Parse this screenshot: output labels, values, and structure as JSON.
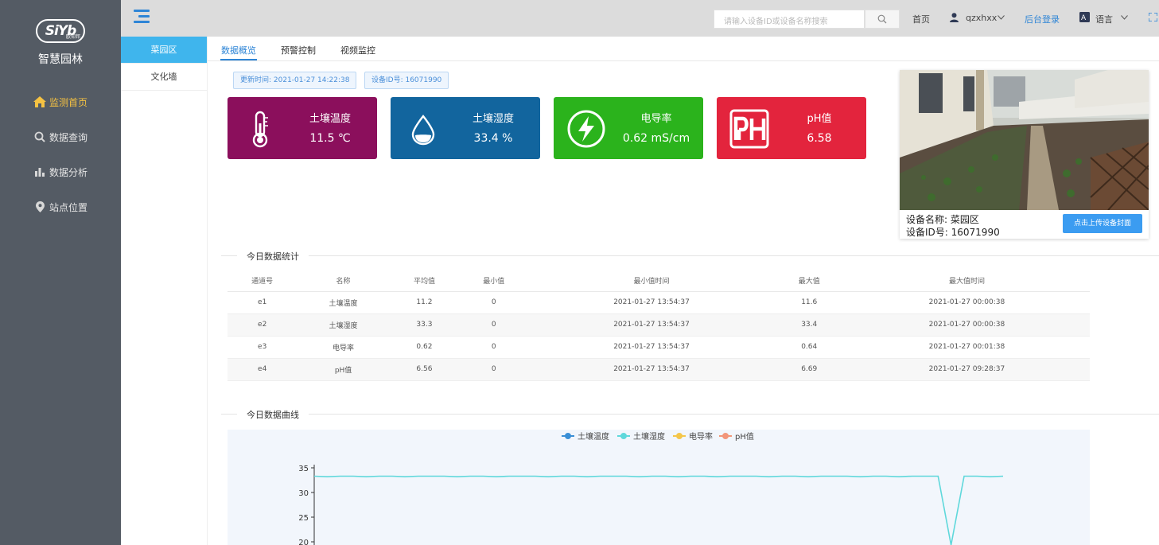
{
  "sidebar": {
    "logo_text": "SiYb",
    "logo_sub": "欧仰邦",
    "app_title": "智慧园林",
    "items": [
      {
        "label": "监测首页",
        "icon": "home-icon",
        "active": true
      },
      {
        "label": "数据查询",
        "icon": "search-icon",
        "active": false
      },
      {
        "label": "数据分析",
        "icon": "bar-chart-icon",
        "active": false
      },
      {
        "label": "站点位置",
        "icon": "location-pin-icon",
        "active": false
      }
    ]
  },
  "header": {
    "search_placeholder": "请输入设备ID或设备名称搜索",
    "home_label": "首页",
    "username": "qzxhxx",
    "admin_login": "后台登录",
    "language": "语言"
  },
  "areas": [
    {
      "label": "菜园区",
      "active": true
    },
    {
      "label": "文化墙",
      "active": false
    }
  ],
  "tabs": [
    {
      "label": "数据概览",
      "active": true
    },
    {
      "label": "预警控制",
      "active": false
    },
    {
      "label": "视频监控",
      "active": false
    }
  ],
  "info": {
    "update_time": "更新时间: 2021-01-27 14:22:38",
    "device_id": "设备ID号: 16071990"
  },
  "cards": [
    {
      "title": "土壤温度",
      "value": "11.5 ℃",
      "color": "#8b0f5c",
      "icon": "thermometer-icon"
    },
    {
      "title": "土壤湿度",
      "value": "33.4 %",
      "color": "#12659e",
      "icon": "water-drop-icon"
    },
    {
      "title": "电导率",
      "value": "0.62 mS/cm",
      "color": "#2bb31c",
      "icon": "lightning-icon"
    },
    {
      "title": "pH值",
      "value": "6.58",
      "color": "#e3243d",
      "icon": "ph-icon"
    }
  ],
  "device": {
    "name_line": "设备名称: 菜园区",
    "id_line": "设备ID号: 16071990",
    "upload_label": "点击上传设备封面"
  },
  "stats": {
    "section_title": "今日数据统计",
    "headers": [
      "通道号",
      "名称",
      "平均值",
      "最小值",
      "最小值时间",
      "最大值",
      "最大值时间"
    ],
    "rows": [
      [
        "e1",
        "土壤温度",
        "11.2",
        "0",
        "2021-01-27 13:54:37",
        "11.6",
        "2021-01-27 00:00:38"
      ],
      [
        "e2",
        "土壤湿度",
        "33.3",
        "0",
        "2021-01-27 13:54:37",
        "33.4",
        "2021-01-27 00:00:38"
      ],
      [
        "e3",
        "电导率",
        "0.62",
        "0",
        "2021-01-27 13:54:37",
        "0.64",
        "2021-01-27 00:01:38"
      ],
      [
        "e4",
        "pH值",
        "6.56",
        "0",
        "2021-01-27 13:54:37",
        "6.69",
        "2021-01-27 09:28:37"
      ]
    ]
  },
  "curve_section_title": "今日数据曲线",
  "chart_data": {
    "type": "line",
    "title": "",
    "legend_position": "top-center",
    "series": [
      {
        "name": "土壤温度",
        "color": "#3a8fd6",
        "values": []
      },
      {
        "name": "土壤湿度",
        "color": "#5fd8db",
        "values": [
          33.3,
          33.2,
          33.3,
          33.3,
          33.2,
          33.3,
          33.3,
          33.2,
          33.3,
          33.3,
          33.3,
          33.2,
          33.3,
          33.3,
          33.2,
          33.3,
          33.3,
          33.3,
          33.2,
          33.3,
          33.3,
          33.2,
          33.3,
          33.3,
          33.3,
          33.2,
          33.3,
          33.3,
          33.2,
          33.3,
          33.3,
          33.2,
          33.3,
          33.3,
          33.3,
          33.2,
          33.3,
          33.3,
          33.2,
          33.3,
          33.3,
          33.3,
          33.2,
          33.3,
          33.3,
          33.2,
          33.3,
          33.3,
          33.3,
          0,
          33.3,
          33.3,
          33.2,
          33.3
        ]
      },
      {
        "name": "电导率",
        "color": "#f4c64a",
        "values": []
      },
      {
        "name": "pH值",
        "color": "#f2967a",
        "values": []
      }
    ],
    "y_ticks": [
      "35",
      "30",
      "25",
      "20"
    ],
    "ylim": [
      0,
      35
    ]
  }
}
